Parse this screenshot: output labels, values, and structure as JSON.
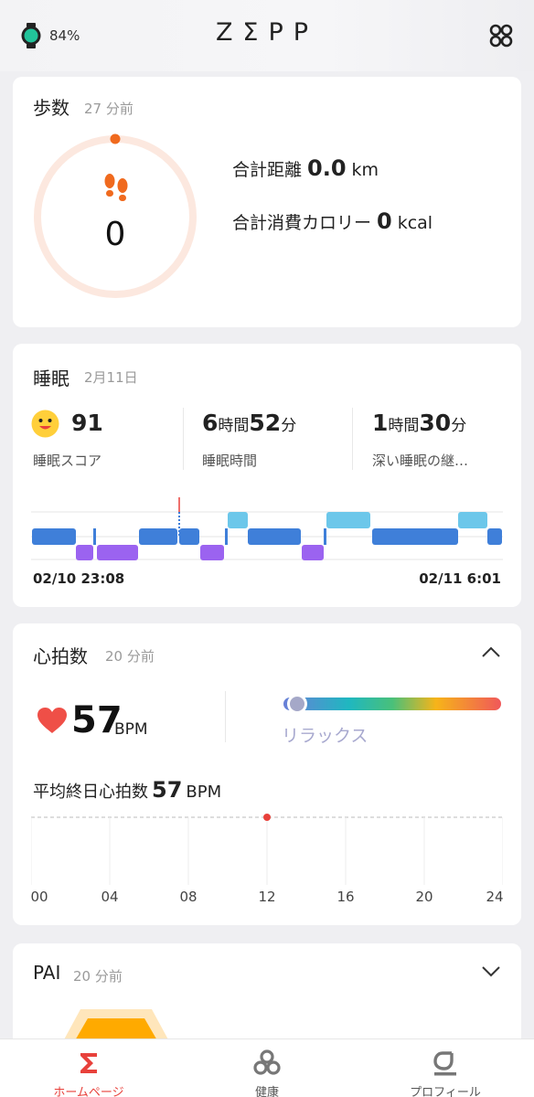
{
  "header": {
    "battery": "84%",
    "logo": "ZΣPP"
  },
  "steps": {
    "title": "歩数",
    "updated": "27 分前",
    "count": "0",
    "distance_label": "合計距離",
    "distance_value": "0.0",
    "distance_unit": "km",
    "calories_label": "合計消費カロリー",
    "calories_value": "0",
    "calories_unit": "kcal"
  },
  "sleep": {
    "title": "睡眠",
    "date": "2月11日",
    "score": "91",
    "score_label": "睡眠スコア",
    "duration_h": "6",
    "duration_h_unit": "時間",
    "duration_m": "52",
    "duration_m_unit": "分",
    "duration_label": "睡眠時間",
    "deep_h": "1",
    "deep_h_unit": "時間",
    "deep_m": "30",
    "deep_m_unit": "分",
    "deep_label": "深い睡眠の継…",
    "start_time": "02/10 23:08",
    "end_time": "02/11 6:01",
    "colors": {
      "light": "#3f7fd9",
      "deep": "#9b63f0",
      "rem": "#6cc7ea"
    }
  },
  "heart": {
    "title": "心拍数",
    "updated": "20 分前",
    "bpm": "57",
    "bpm_unit": "BPM",
    "zone_label": "リラックス",
    "avg_label": "平均終日心拍数",
    "avg_value": "57",
    "avg_unit": "BPM",
    "x_ticks": [
      "00",
      "04",
      "08",
      "12",
      "16",
      "20",
      "24"
    ],
    "point_hour": 12,
    "point_value": 57
  },
  "pai": {
    "title": "PAI",
    "updated": "20 分前"
  },
  "nav": {
    "home": "ホームページ",
    "health": "健康",
    "profile": "プロフィール",
    "active_color": "#e8413b"
  }
}
